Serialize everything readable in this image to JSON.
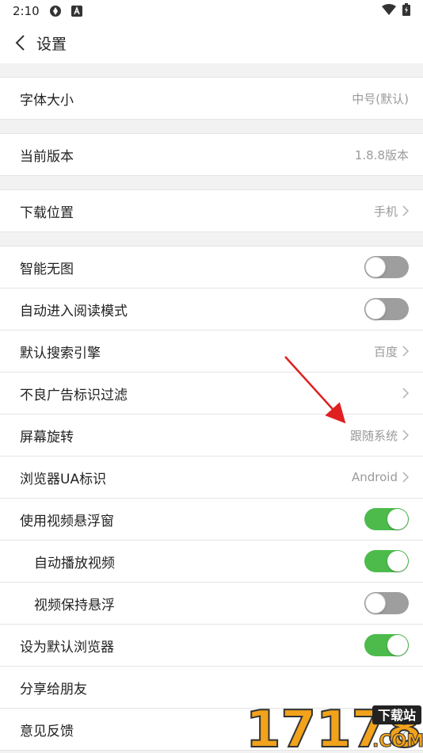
{
  "status_bar": {
    "time": "2:10"
  },
  "header": {
    "title": "设置"
  },
  "rows": {
    "font_size": {
      "label": "字体大小",
      "value": "中号(默认)"
    },
    "version": {
      "label": "当前版本",
      "value": "1.8.8版本"
    },
    "download_location": {
      "label": "下载位置",
      "value": "手机"
    },
    "smart_no_image": {
      "label": "智能无图",
      "enabled": false
    },
    "auto_reading_mode": {
      "label": "自动进入阅读模式",
      "enabled": false
    },
    "default_search_engine": {
      "label": "默认搜索引擎",
      "value": "百度"
    },
    "ad_filter": {
      "label": "不良广告标识过滤"
    },
    "screen_rotation": {
      "label": "屏幕旋转",
      "value": "跟随系统"
    },
    "browser_ua": {
      "label": "浏览器UA标识",
      "value": "Android"
    },
    "video_float_window": {
      "label": "使用视频悬浮窗",
      "enabled": true
    },
    "autoplay_video": {
      "label": "自动播放视频",
      "enabled": true
    },
    "keep_video_floating": {
      "label": "视频保持悬浮",
      "enabled": false
    },
    "set_default_browser": {
      "label": "设为默认浏览器",
      "enabled": true
    },
    "share_friends": {
      "label": "分享给朋友"
    },
    "feedback": {
      "label": "意见反馈"
    }
  },
  "watermark": {
    "number": "17178",
    "badge": "下载站",
    "domain": ".COM"
  },
  "colors": {
    "toggle_on": "#4cbb4c",
    "toggle_off": "#9e9e9e",
    "annotation_arrow": "#e02020",
    "watermark_orange": "#f2a31b"
  }
}
